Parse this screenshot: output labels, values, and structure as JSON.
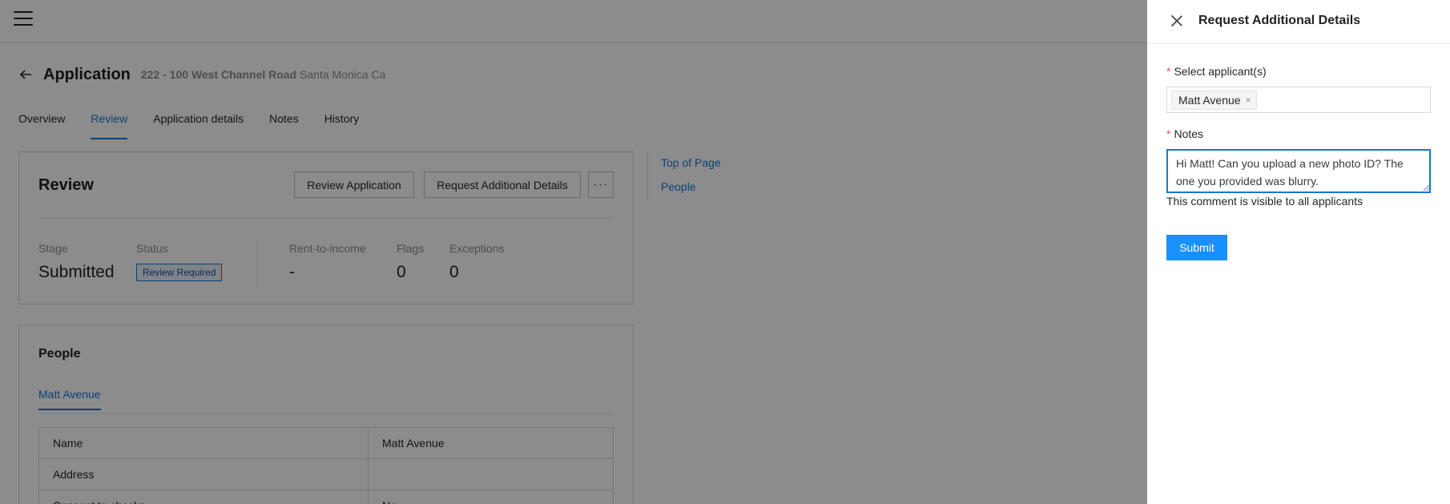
{
  "app": {
    "title": "Application",
    "address_bold": "222 - 100 West Channel Road",
    "address_rest": "Santa Monica Ca"
  },
  "tabs": [
    {
      "label": "Overview",
      "active": false
    },
    {
      "label": "Review",
      "active": true
    },
    {
      "label": "Application details",
      "active": false
    },
    {
      "label": "Notes",
      "active": false
    },
    {
      "label": "History",
      "active": false
    }
  ],
  "review": {
    "title": "Review",
    "review_button": "Review Application",
    "request_button": "Request Additional Details",
    "more_button": "···",
    "stats": {
      "stage": {
        "label": "Stage",
        "value": "Submitted"
      },
      "status": {
        "label": "Status",
        "value": "Review Required"
      },
      "rent_to_income": {
        "label": "Rent-to-income",
        "value": "-"
      },
      "flags": {
        "label": "Flags",
        "value": "0"
      },
      "exceptions": {
        "label": "Exceptions",
        "value": "0"
      }
    }
  },
  "people": {
    "title": "People",
    "tab": "Matt Avenue",
    "rows": [
      {
        "key": "Name",
        "value": "Matt Avenue"
      },
      {
        "key": "Address",
        "value": ""
      },
      {
        "key": "Consent to checks",
        "value": "No"
      }
    ]
  },
  "anchor_nav": {
    "top_of_page": "Top of Page",
    "people": "People"
  },
  "drawer": {
    "title": "Request Additional Details",
    "applicants_label": "Select applicant(s)",
    "selected_applicant": "Matt Avenue",
    "tag_remove": "×",
    "notes_label": "Notes",
    "notes_value": "Hi Matt! Can you upload a new photo ID? The one you provided was blurry.",
    "help_text": "This comment is visible to all applicants",
    "submit": "Submit",
    "required_mark": "*"
  },
  "colors": {
    "accent": "#1677d8",
    "primary_button": "#1890ff",
    "required": "#ff4d4f"
  }
}
